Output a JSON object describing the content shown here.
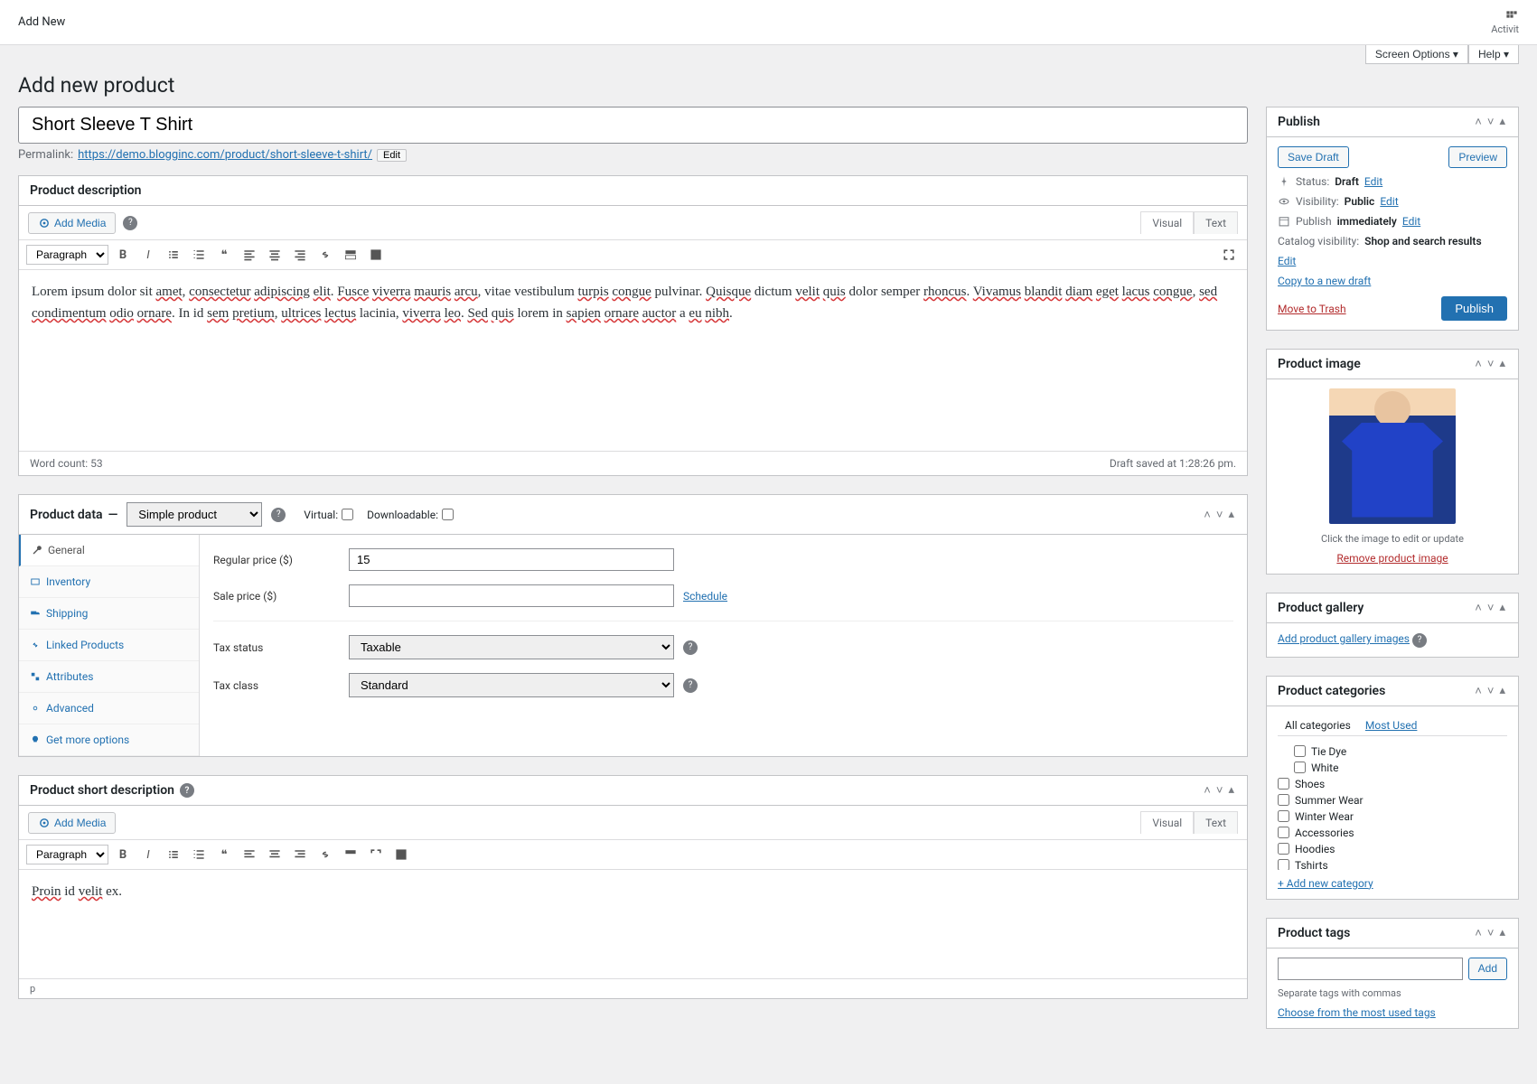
{
  "top_bar": {
    "title": "Add New",
    "activity": "Activit"
  },
  "screen_meta": {
    "screen_options": "Screen Options",
    "help": "Help"
  },
  "page_title": "Add new product",
  "product_title": "Short Sleeve T Shirt",
  "permalink": {
    "label": "Permalink:",
    "url_prefix": "https://demo.blogginc.com/",
    "url_path": "product/short-sleeve-t-shirt/",
    "edit": "Edit"
  },
  "description_box": {
    "title": "Product description",
    "add_media": "Add Media",
    "tabs": {
      "visual": "Visual",
      "text": "Text"
    },
    "format": "Paragraph",
    "content": "Lorem ipsum dolor sit amet, consectetur adipiscing elit. Fusce viverra mauris arcu, vitae vestibulum turpis congue pulvinar. Quisque dictum velit quis dolor semper rhoncus. Vivamus blandit diam eget lacus congue, sed condimentum odio ornare. In id sem pretium, ultrices lectus lacinia, viverra leo. Sed quis lorem in sapien ornare auctor a eu nibh.",
    "word_count": "Word count: 53",
    "draft_saved": "Draft saved at 1:28:26 pm."
  },
  "product_data": {
    "title": "Product data",
    "type": "Simple product",
    "virtual_label": "Virtual:",
    "downloadable_label": "Downloadable:",
    "tabs": {
      "general": "General",
      "inventory": "Inventory",
      "shipping": "Shipping",
      "linked": "Linked Products",
      "attributes": "Attributes",
      "advanced": "Advanced",
      "get_more": "Get more options"
    },
    "fields": {
      "regular_price_label": "Regular price ($)",
      "regular_price_value": "15",
      "sale_price_label": "Sale price ($)",
      "sale_price_value": "",
      "schedule": "Schedule",
      "tax_status_label": "Tax status",
      "tax_status_value": "Taxable",
      "tax_class_label": "Tax class",
      "tax_class_value": "Standard"
    }
  },
  "short_description": {
    "title": "Product short description",
    "add_media": "Add Media",
    "tabs": {
      "visual": "Visual",
      "text": "Text"
    },
    "format": "Paragraph",
    "content": "Proin id velit ex.",
    "path": "p"
  },
  "publish": {
    "title": "Publish",
    "save_draft": "Save Draft",
    "preview": "Preview",
    "status_label": "Status:",
    "status_value": "Draft",
    "visibility_label": "Visibility:",
    "visibility_value": "Public",
    "publish_label": "Publish",
    "publish_value": "immediately",
    "catalog_label": "Catalog visibility:",
    "catalog_value": "Shop and search results",
    "edit": "Edit",
    "copy_draft": "Copy to a new draft",
    "move_trash": "Move to Trash",
    "publish_btn": "Publish"
  },
  "product_image": {
    "title": "Product image",
    "hint": "Click the image to edit or update",
    "remove": "Remove product image"
  },
  "product_gallery": {
    "title": "Product gallery",
    "add": "Add product gallery images"
  },
  "categories": {
    "title": "Product categories",
    "all": "All categories",
    "most_used": "Most Used",
    "items": [
      {
        "label": "Tie Dye",
        "nested": true
      },
      {
        "label": "White",
        "nested": true
      },
      {
        "label": "Shoes",
        "nested": false
      },
      {
        "label": "Summer Wear",
        "nested": false
      },
      {
        "label": "Winter Wear",
        "nested": false
      },
      {
        "label": "Accessories",
        "nested": false
      },
      {
        "label": "Hoodies",
        "nested": false
      },
      {
        "label": "Tshirts",
        "nested": false
      }
    ],
    "add_new": "+ Add new category"
  },
  "tags": {
    "title": "Product tags",
    "add_btn": "Add",
    "hint": "Separate tags with commas",
    "choose": "Choose from the most used tags"
  }
}
